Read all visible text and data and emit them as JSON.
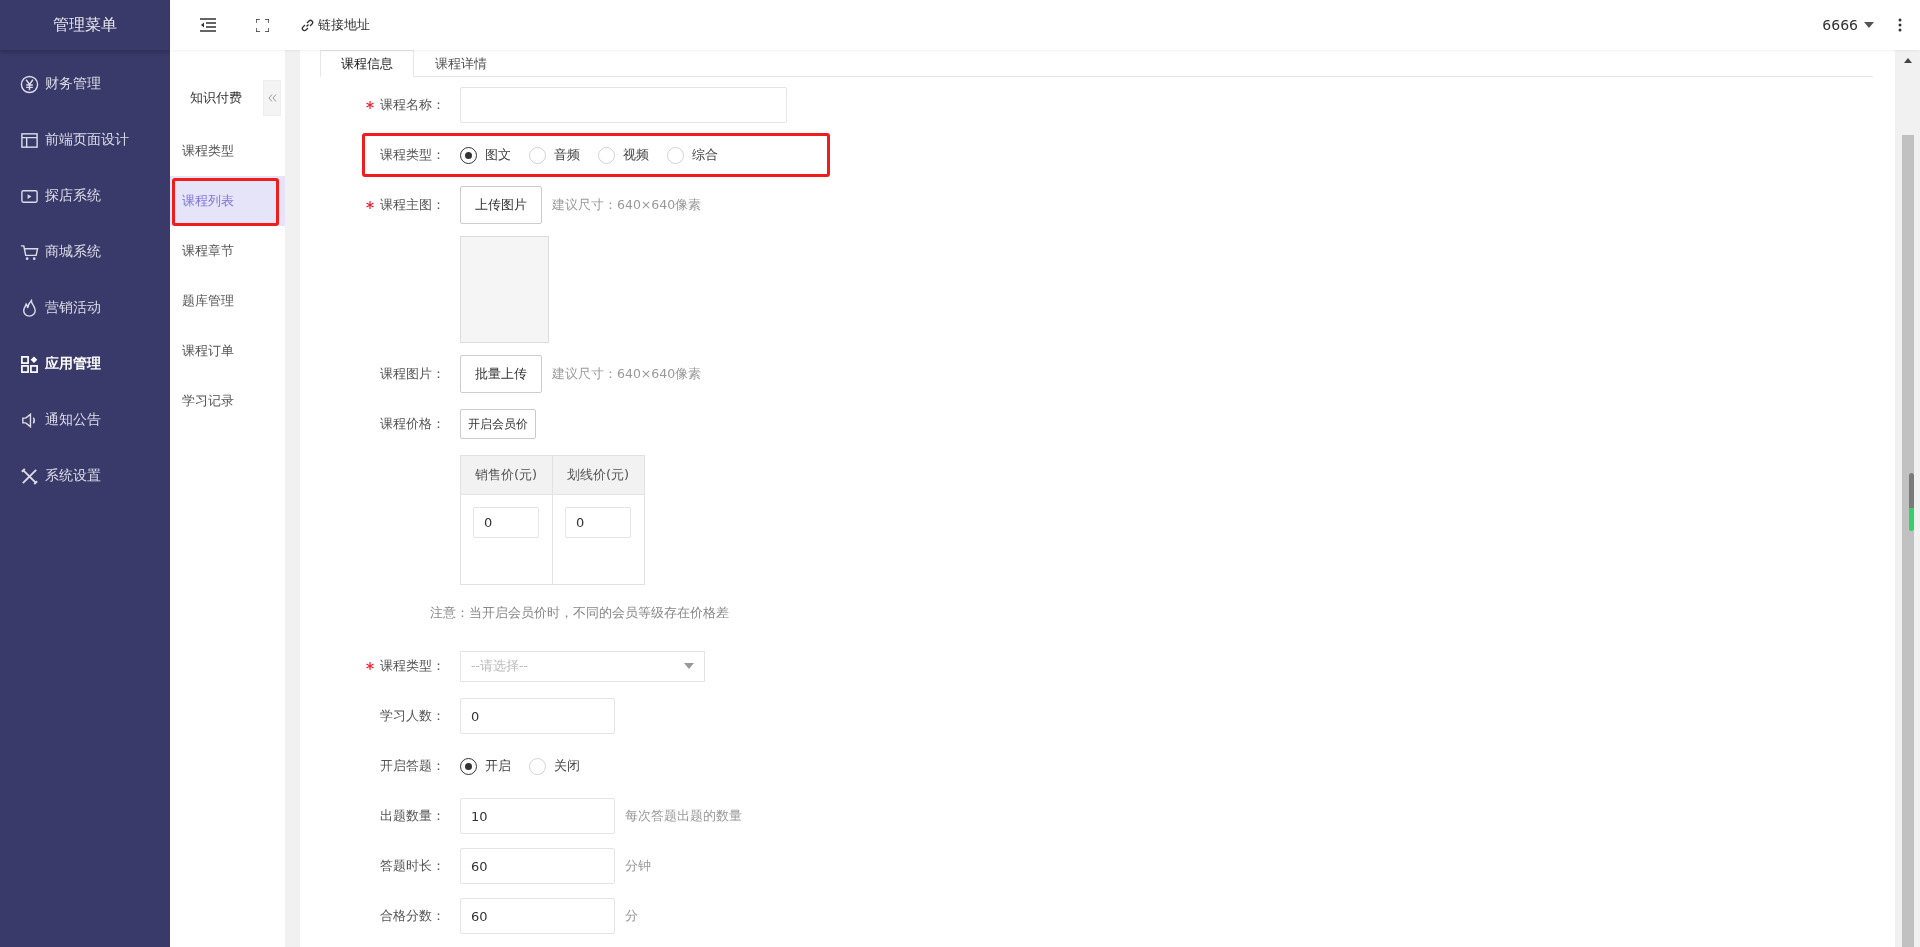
{
  "sidebar": {
    "title": "管理菜单",
    "items": [
      {
        "label": "财务管理",
        "selected": false
      },
      {
        "label": "前端页面设计",
        "selected": false
      },
      {
        "label": "探店系统",
        "selected": false
      },
      {
        "label": "商城系统",
        "selected": false
      },
      {
        "label": "营销活动",
        "selected": false
      },
      {
        "label": "应用管理",
        "selected": true
      },
      {
        "label": "通知公告",
        "selected": false
      },
      {
        "label": "系统设置",
        "selected": false
      }
    ]
  },
  "header": {
    "link_label": "链接地址",
    "user": "6666"
  },
  "submenu": {
    "title": "知识付费",
    "items": [
      {
        "label": "课程类型",
        "selected": false,
        "highlighted": false
      },
      {
        "label": "课程列表",
        "selected": true,
        "highlighted": true
      },
      {
        "label": "课程章节",
        "selected": false,
        "highlighted": false
      },
      {
        "label": "题库管理",
        "selected": false,
        "highlighted": false
      },
      {
        "label": "课程订单",
        "selected": false,
        "highlighted": false
      },
      {
        "label": "学习记录",
        "selected": false,
        "highlighted": false
      }
    ]
  },
  "tabs": [
    {
      "label": "课程信息",
      "selected": true
    },
    {
      "label": "课程详情",
      "selected": false
    }
  ],
  "form": {
    "rows": [
      {
        "kind": "wide_input",
        "label": "课程名称：",
        "required": true
      },
      {
        "kind": "radio",
        "label": "课程类型：",
        "highlighted": true,
        "options": [
          {
            "label": "图文",
            "selected": true
          },
          {
            "label": "音频",
            "selected": false
          },
          {
            "label": "视频",
            "selected": false
          },
          {
            "label": "综合",
            "selected": false
          }
        ]
      },
      {
        "kind": "upload",
        "label": "课程主图：",
        "required": true,
        "button": "上传图片",
        "hint": "建议尺寸：640×640像素"
      },
      {
        "kind": "image_slot"
      },
      {
        "kind": "upload",
        "label": "课程图片：",
        "button": "批量上传",
        "hint": "建议尺寸：640×640像素"
      },
      {
        "kind": "small_button",
        "label": "课程价格：",
        "button": "开启会员价"
      },
      {
        "kind": "price_table",
        "columns": [
          "销售价(元)",
          "划线价(元)"
        ],
        "values": [
          "0",
          "0"
        ]
      },
      {
        "kind": "note",
        "text": "注意：当开启会员价时，不同的会员等级存在价格差"
      },
      {
        "kind": "select",
        "label": "课程类型：",
        "required": true,
        "placeholder": "--请选择--"
      },
      {
        "kind": "input",
        "label": "学习人数：",
        "value": "0"
      },
      {
        "kind": "radio",
        "label": "开启答题：",
        "options": [
          {
            "label": "开启",
            "selected": true
          },
          {
            "label": "关闭",
            "selected": false
          }
        ]
      },
      {
        "kind": "input",
        "label": "出题数量：",
        "value": "10",
        "hint": "每次答题出题的数量"
      },
      {
        "kind": "input",
        "label": "答题时长：",
        "value": "60",
        "hint": "分钟"
      },
      {
        "kind": "input",
        "label": "合格分数：",
        "value": "60",
        "hint": "分"
      }
    ]
  }
}
